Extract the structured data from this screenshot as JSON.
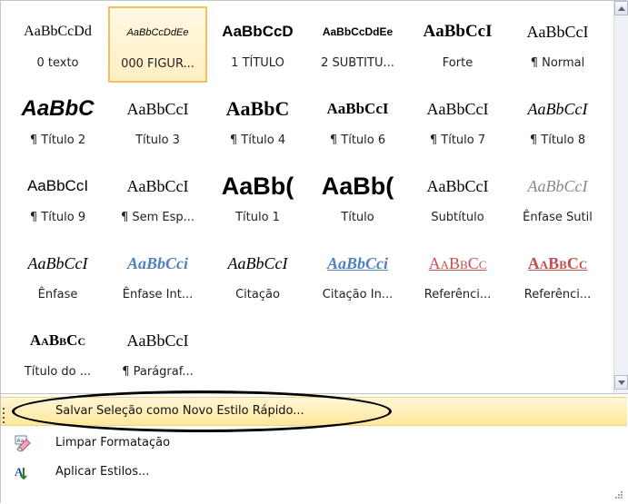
{
  "gallery": {
    "styles": [
      {
        "sample": "AaBbCcDd",
        "label": "0 texto",
        "cls": "s-serif",
        "selected": false
      },
      {
        "sample": "AaBbCcDdEe",
        "label": "000 FIGUR...",
        "cls": "s-sans-it-sm",
        "selected": true
      },
      {
        "sample": "AaBbCcD",
        "label": "1 TÍTULO",
        "cls": "s-sans-b",
        "selected": false
      },
      {
        "sample": "AaBbCcDdEe",
        "label": "2 SUBTITU...",
        "cls": "s-sans-b-sm",
        "selected": false
      },
      {
        "sample": "AaBbCcI",
        "label": "Forte",
        "cls": "s-serif-b",
        "selected": false
      },
      {
        "sample": "AaBbCcI",
        "label": "¶ Normal",
        "cls": "s-serif-lg",
        "selected": false
      },
      {
        "sample": "AaBbC",
        "label": "¶ Título 2",
        "cls": "s-sans-bi-lg",
        "selected": false
      },
      {
        "sample": "AaBbCcI",
        "label": "Título 3",
        "cls": "s-serif-lg",
        "selected": false
      },
      {
        "sample": "AaBbC",
        "label": "¶ Título 4",
        "cls": "s-serif-b-lg",
        "selected": false
      },
      {
        "sample": "AaBbCcI",
        "label": "¶ Título 6",
        "cls": "s-serif-b-md",
        "selected": false
      },
      {
        "sample": "AaBbCcI",
        "label": "¶ Título 7",
        "cls": "s-serif-lg",
        "selected": false
      },
      {
        "sample": "AaBbCcI",
        "label": "¶ Título 8",
        "cls": "s-serif-i",
        "selected": false
      },
      {
        "sample": "AaBbCcI",
        "label": "¶ Título 9",
        "cls": "s-sans-md",
        "selected": false
      },
      {
        "sample": "AaBbCcI",
        "label": "¶ Sem Esp...",
        "cls": "s-serif-lg",
        "selected": false
      },
      {
        "sample": "AaBb(",
        "label": "Título 1",
        "cls": "s-sans-b-xl",
        "selected": false
      },
      {
        "sample": "AaBb(",
        "label": "Título",
        "cls": "s-sans-xl-b",
        "selected": false
      },
      {
        "sample": "AaBbCcI",
        "label": "Subtítulo",
        "cls": "s-serif-lg",
        "selected": false
      },
      {
        "sample": "AaBbCcI",
        "label": "Ênfase Sutil",
        "cls": "s-gray-i",
        "selected": false
      },
      {
        "sample": "AaBbCcI",
        "label": "Ênfase",
        "cls": "s-serif-i",
        "selected": false
      },
      {
        "sample": "AaBbCci",
        "label": "Ênfase Int...",
        "cls": "s-blue-bi",
        "selected": false
      },
      {
        "sample": "AaBbCcI",
        "label": "Citação",
        "cls": "s-serif-i",
        "selected": false
      },
      {
        "sample": "AaBbCci",
        "label": "Citação In...",
        "cls": "s-blue-bi-ul",
        "selected": false
      },
      {
        "sample": "AaBbCc",
        "label": "Referênci...",
        "cls": "s-red-sc",
        "selected": false
      },
      {
        "sample": "AaBbCc",
        "label": "Referênci...",
        "cls": "s-red-sc-b",
        "selected": false
      },
      {
        "sample": "AaBbCc",
        "label": "Título do ...",
        "cls": "s-sc-b",
        "selected": false
      },
      {
        "sample": "AaBbCcI",
        "label": "¶ Parágraf...",
        "cls": "s-serif-lg",
        "selected": false
      }
    ]
  },
  "menu": {
    "save_label": "Salvar Seleção como Novo Estilo Rápido...",
    "clear_label": "Limpar Formatação",
    "apply_label": "Aplicar Estilos..."
  },
  "colors": {
    "selection_border": "#f1c15f",
    "highlight": "#ffe79b",
    "blue_emphasis": "#4f81bd",
    "red_reference": "#c0504d"
  }
}
